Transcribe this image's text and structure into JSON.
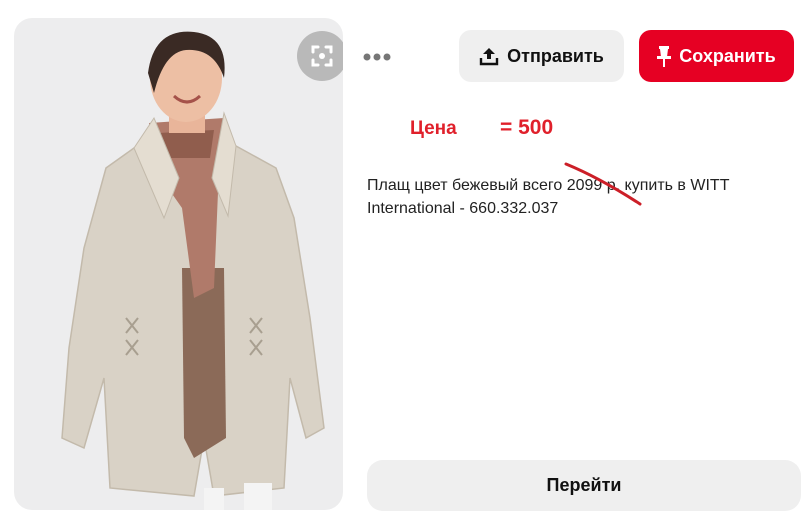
{
  "toolbar": {
    "share_label": "Отправить",
    "save_label": "Сохранить",
    "more_icon": "more-horizontal-icon",
    "share_icon": "upload-icon",
    "save_icon": "pushpin-icon"
  },
  "image": {
    "visual_search_icon": "crop-scan-icon",
    "subject": "product-photo"
  },
  "price_annotation": {
    "label": "Цена",
    "value": "= 500",
    "color": "#e0202b"
  },
  "pin": {
    "description_line1": "Плащ цвет бежевый всего 2099 р. купить в WITT",
    "description_line2": "International - 660.332.037"
  },
  "visit": {
    "label": "Перейти"
  },
  "colors": {
    "brand_red": "#e60023",
    "button_gray": "#efefef",
    "image_bg": "#ededee"
  }
}
